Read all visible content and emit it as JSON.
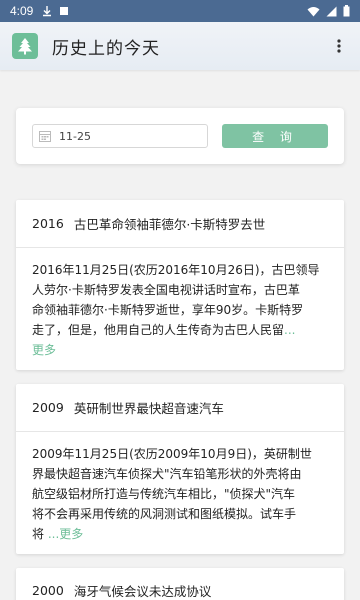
{
  "status_bar": {
    "time": "4:09"
  },
  "app_bar": {
    "title": "历史上的今天"
  },
  "search": {
    "date_value": "11-25",
    "button_label": "查 询"
  },
  "events": [
    {
      "year": "2016",
      "title": "古巴革命领袖菲德尔·卡斯特罗去世",
      "body_lines": [
        "2016年11月25日(农历2016年10月26日)，古巴领导",
        "人劳尔·卡斯特罗发表全国电视讲话时宣布，古巴革",
        "命领袖菲德尔·卡斯特罗逝世，享年90岁。卡斯特罗",
        "走了，但是，他用自己的人生传奇为古巴人民留"
      ],
      "ellipsis": "...",
      "more": "更多"
    },
    {
      "year": "2009",
      "title": "英研制世界最快超音速汽车",
      "body_lines": [
        "2009年11月25日(农历2009年10月9日)，英研制世",
        "界最快超音速汽车侦探犬\"汽车铅笔形状的外壳将由",
        "航空级铝材所打造与传统汽车相比，\"侦探犬\"汽车",
        "将不会再采用传统的风洞测试和图纸模拟。试车手",
        "将"
      ],
      "ellipsis": "...",
      "more": "更多"
    },
    {
      "year": "2000",
      "title": "海牙气候会议未达成协议"
    }
  ]
}
